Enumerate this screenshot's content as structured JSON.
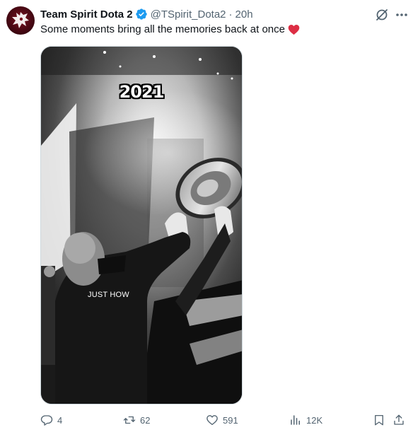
{
  "tweet": {
    "display_name": "Team Spirit Dota 2",
    "handle": "@TSpirit_Dota2",
    "separator": "·",
    "time": "20h",
    "text": "Some moments bring all the memories back at once",
    "emoji": "heart-emoji",
    "verified": true
  },
  "media": {
    "overlay_year": "2021",
    "overlay_subtitle": "JUST HOW"
  },
  "actions": {
    "replies": "4",
    "reposts": "62",
    "likes": "591",
    "views": "12K"
  },
  "icons": {
    "avatar": "team-spirit-logo",
    "verified": "verified-badge-icon",
    "grok": "grok-icon",
    "more": "more-icon",
    "reply": "reply-icon",
    "repost": "repost-icon",
    "like": "like-icon",
    "views": "views-icon",
    "bookmark": "bookmark-icon",
    "share": "share-icon"
  },
  "colors": {
    "text": "#0f1419",
    "secondary": "#536471",
    "verified": "#1d9bf0",
    "heart": "#e0245e",
    "avatar_bg": "#3b0610"
  }
}
